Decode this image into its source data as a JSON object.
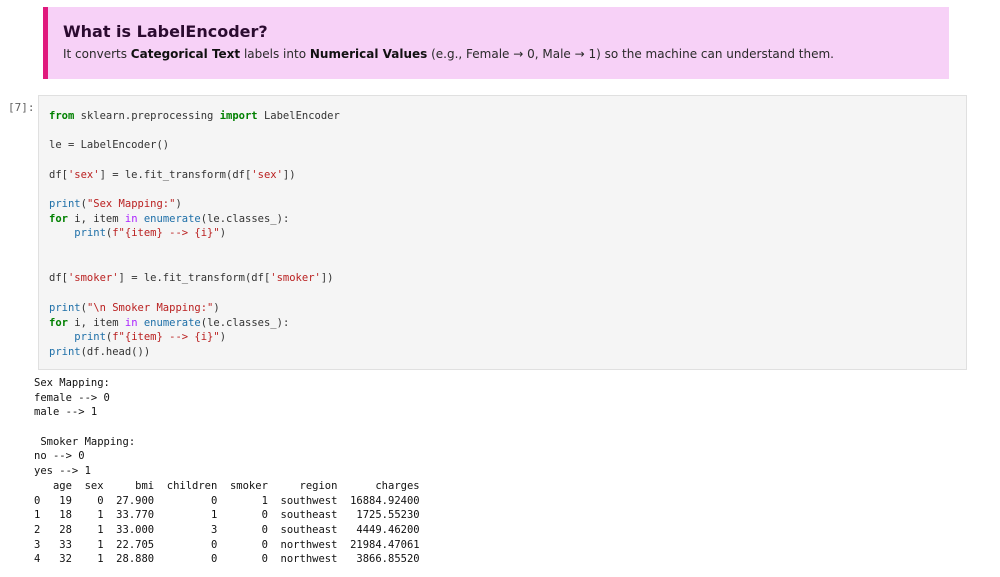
{
  "callout": {
    "title": "What is LabelEncoder?",
    "intro": "It converts ",
    "bold1": "Categorical Text",
    "mid": " labels into ",
    "bold2": "Numerical Values",
    "tail": " (e.g., Female → 0, Male → 1) so the machine can understand them."
  },
  "cell": {
    "prompt": "[7]:"
  },
  "code": {
    "l1_kw1": "from",
    "l1_mod": " sklearn.preprocessing ",
    "l1_kw2": "import",
    "l1_name": " LabelEncoder",
    "l2": "le = LabelEncoder()",
    "l3_a": "df[",
    "l3_s1": "'sex'",
    "l3_b": "] = le.fit_transform(df[",
    "l3_s2": "'sex'",
    "l3_c": "])",
    "l4_fn": "print",
    "l4_a": "(",
    "l4_s": "\"Sex Mapping:\"",
    "l4_b": ")",
    "l5_kw1": "for",
    "l5_a": " i, item ",
    "l5_kw2": "in",
    "l5_sp": " ",
    "l5_fn": "enumerate",
    "l5_b": "(le.classes_):",
    "l6_ind": "    ",
    "l6_fn": "print",
    "l6_a": "(",
    "l6_s": "f\"{item} --> {i}\"",
    "l6_b": ")",
    "l7_a": "df[",
    "l7_s1": "'smoker'",
    "l7_b": "] = le.fit_transform(df[",
    "l7_s2": "'smoker'",
    "l7_c": "])",
    "l8_fn": "print",
    "l8_a": "(",
    "l8_s": "\"\\n Smoker Mapping:\"",
    "l8_b": ")",
    "l9_kw1": "for",
    "l9_a": " i, item ",
    "l9_kw2": "in",
    "l9_sp": " ",
    "l9_fn": "enumerate",
    "l9_b": "(le.classes_):",
    "l10_ind": "    ",
    "l10_fn": "print",
    "l10_a": "(",
    "l10_s": "f\"{item} --> {i}\"",
    "l10_b": ")",
    "l11_fn": "print",
    "l11_a": "(df.head())"
  },
  "output": {
    "lines": [
      "Sex Mapping:",
      "female --> 0",
      "male --> 1",
      "",
      " Smoker Mapping:",
      "no --> 0",
      "yes --> 1",
      "   age  sex     bmi  children  smoker     region      charges",
      "0   19    0  27.900         0       1  southwest  16884.92400",
      "1   18    1  33.770         1       0  southeast   1725.55230",
      "2   28    1  33.000         3       0  southeast   4449.46200",
      "3   33    1  22.705         0       0  northwest  21984.47061",
      "4   32    1  28.880         0       0  northwest   3866.85520"
    ]
  }
}
